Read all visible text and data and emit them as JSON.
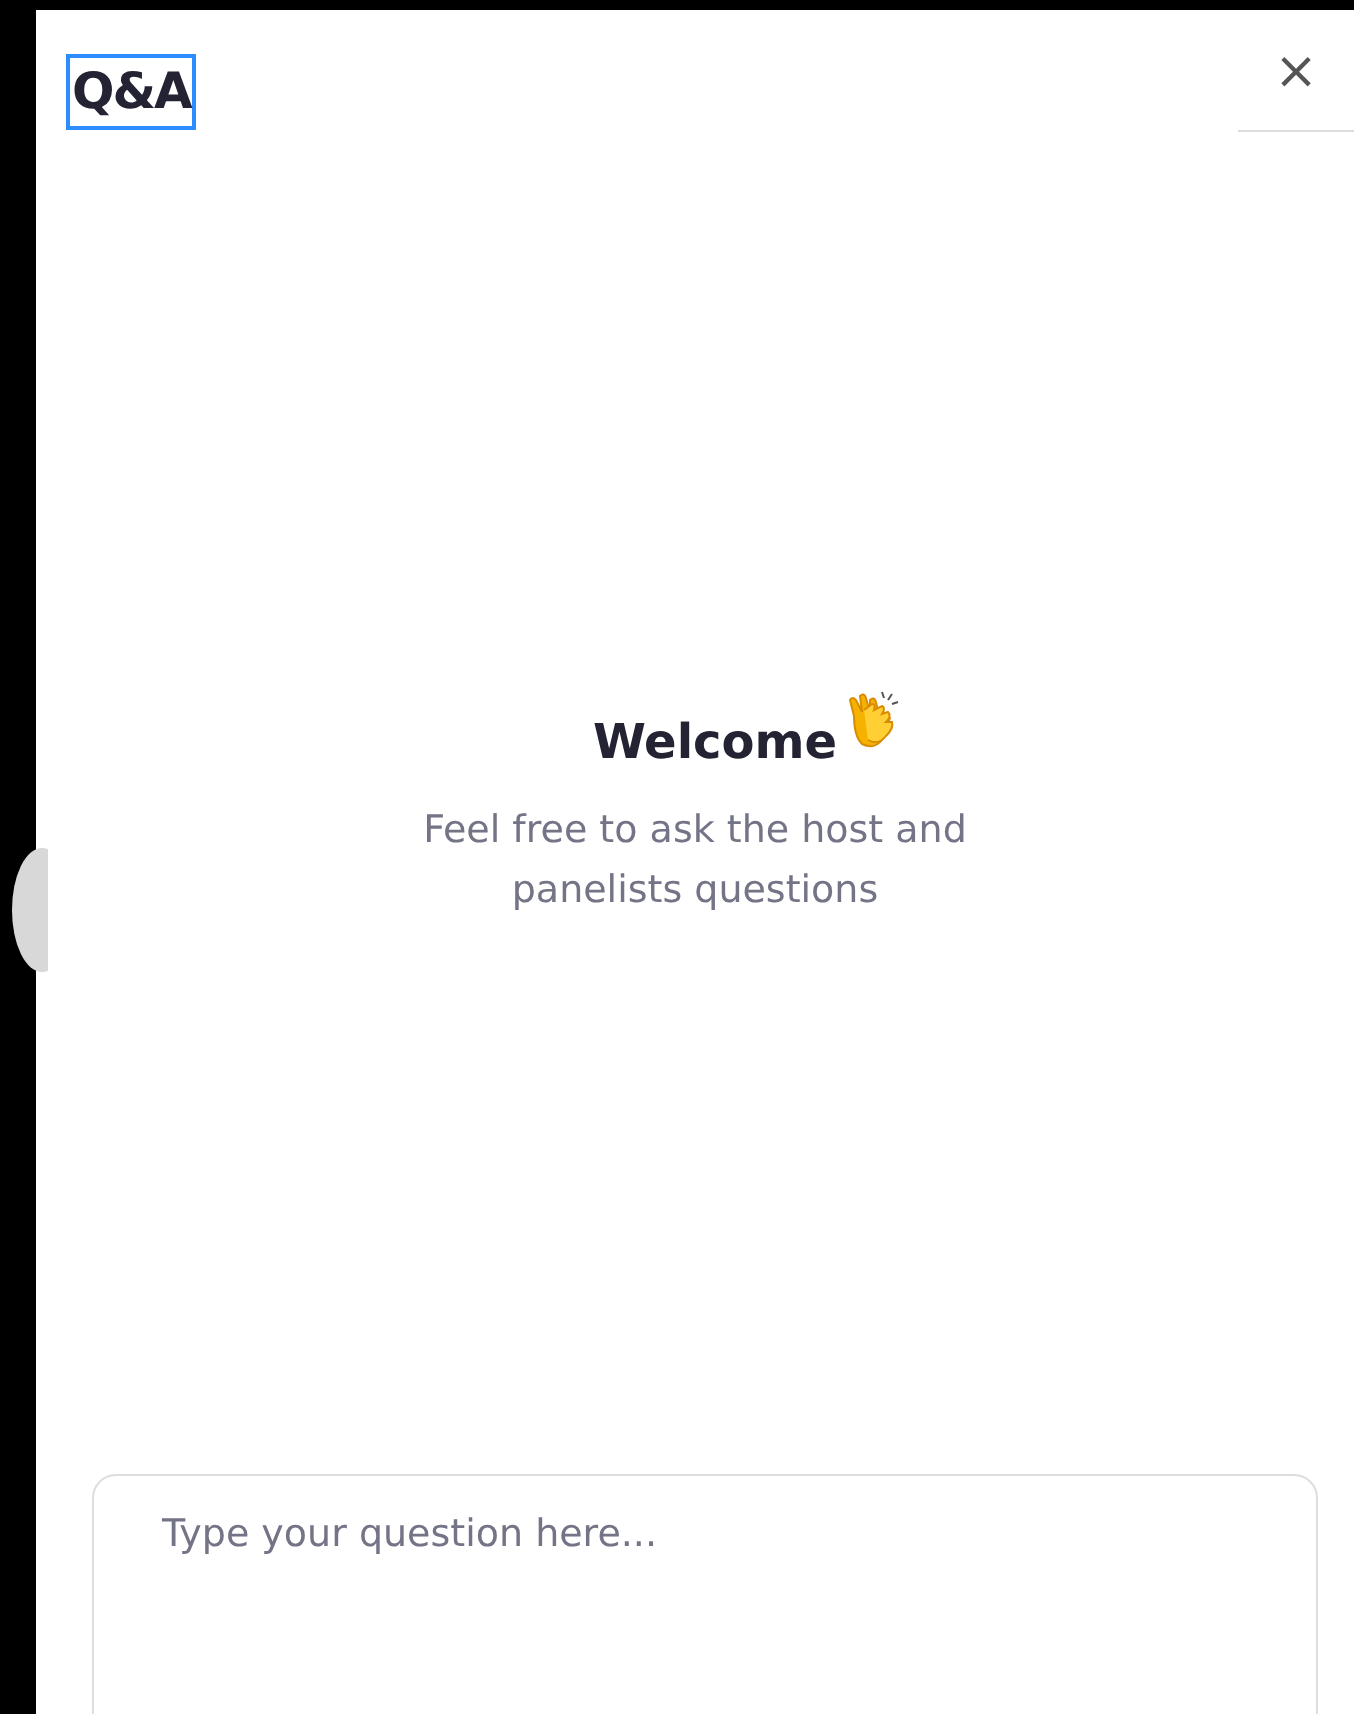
{
  "header": {
    "title": "Q&A",
    "title_focused": true,
    "close": "×"
  },
  "welcome": {
    "heading": "Welcome",
    "message": "Feel free to ask the host and panelists questions"
  },
  "question_field": {
    "placeholder": "Type your question here..."
  }
}
